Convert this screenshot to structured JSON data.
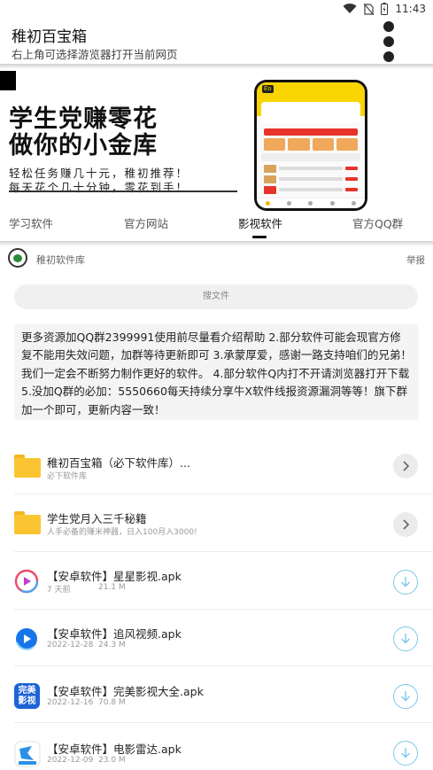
{
  "status_bar": {
    "time": "11:43"
  },
  "header": {
    "title": "稚初百宝箱",
    "subtitle": "右上角可选择游览器打开当前网页"
  },
  "banner": {
    "line1": "学生党赚零花",
    "line2": "做你的小金库",
    "line3": "轻松任务赚几十元，稚初推荐！",
    "line4": "每天花个几十分钟，零花到手！"
  },
  "tabs": [
    {
      "label": "学习软件"
    },
    {
      "label": "官方网站"
    },
    {
      "label": "影视软件",
      "active": true
    },
    {
      "label": "官方QQ群"
    }
  ],
  "repo": {
    "name": "稚初软件库",
    "report": "举报"
  },
  "search": {
    "placeholder": "搜文件"
  },
  "notice": "更多资源加QQ群2399991使用前尽量看介绍帮助 2.部分软件可能会现官方修复不能用失效问题，加群等待更新即可 3.承蒙厚爱，感谢一路支持咱们的兄弟！我们一定会不断努力制作更好的软件。 4.部分软件Q内打不开请浏览器打开下载 5.没加Q群的必加：5550660每天持续分享牛X软件线报资源漏洞等等！旗下群加一个即可，更新内容一致！",
  "folders": [
    {
      "title": "稚初百宝箱（必下软件库）...",
      "subtitle": "必下软件库"
    },
    {
      "title": "学生党月入三千秘籍",
      "subtitle": "人手必备的赚米神器，日入100月入3000!"
    }
  ],
  "files": [
    {
      "title": "【安卓软件】星星影视.apk",
      "date": "7 天前",
      "size": "21.1 M",
      "icon": "star-video-icon"
    },
    {
      "title": "【安卓软件】追风视频.apk",
      "date": "2022-12-28",
      "size": "24.3 M",
      "icon": "zhuifeng-play-icon"
    },
    {
      "title": "【安卓软件】完美影视大全.apk",
      "date": "2022-12-16",
      "size": "70.8 M",
      "icon": "wanmei-video-icon",
      "icon_text": "完美影视"
    },
    {
      "title": "【安卓软件】电影雷达.apk",
      "date": "2022-12-09",
      "size": "23.0 M",
      "icon": "movie-radar-icon"
    }
  ],
  "colors": {
    "folder": "#fbc531",
    "download_ring": "#7ec8e8",
    "banner_phone": "#f8d400"
  }
}
